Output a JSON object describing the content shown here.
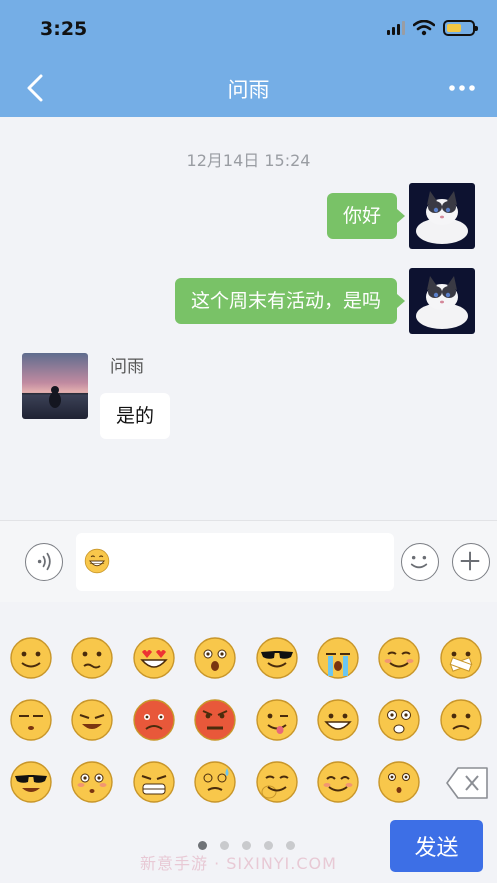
{
  "status_bar": {
    "time": "3:25",
    "battery_level": 0.6
  },
  "header": {
    "back_icon": "chevron-left-icon",
    "title": "问雨",
    "more_icon": "more-horizontal-icon"
  },
  "chat": {
    "timestamp": "12月14日 15:24",
    "messages": [
      {
        "direction": "sent",
        "text": "你好"
      },
      {
        "direction": "sent",
        "text": "这个周末有活动，是吗"
      },
      {
        "direction": "received",
        "sender": "问雨",
        "text": "是的"
      }
    ]
  },
  "input_bar": {
    "voice_icon": "voice-icon",
    "value_emoji": "grinning-emoji",
    "emoji_icon": "smiley-icon",
    "plus_icon": "plus-icon"
  },
  "emoji_panel": {
    "emojis": [
      "smile",
      "wronged",
      "heart-eyes",
      "surprised",
      "cool-sunglasses",
      "crying",
      "shy",
      "sealed-mouth",
      "sleepy",
      "sob",
      "blush-angry",
      "angry",
      "tongue-wink",
      "big-grin",
      "shocked",
      "sad",
      "sunglasses-evil",
      "embarrassed",
      "grimace",
      "dizzy-sweat",
      "sneaky",
      "happy",
      "smart",
      "delete"
    ],
    "page_count": 5,
    "active_page": 1
  },
  "send_button": {
    "label": "发送"
  },
  "watermark": "新意手游 · SIXINYI.COM",
  "colors": {
    "header": "#75aee6",
    "sent_bubble": "#79c267",
    "send_button": "#3d6fe6"
  }
}
